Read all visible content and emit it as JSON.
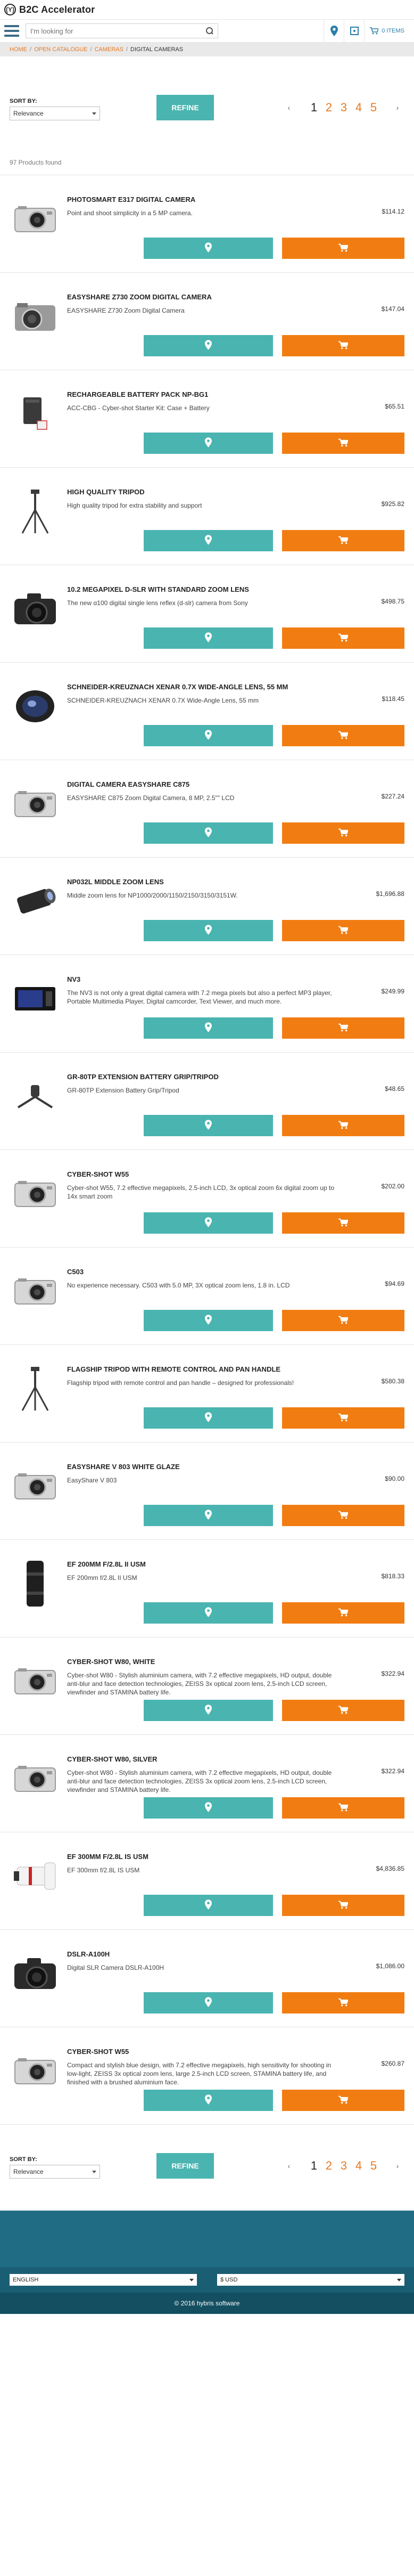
{
  "site": {
    "logo_mark": "(Y)",
    "title": "B2C Accelerator"
  },
  "search": {
    "placeholder": "I'm looking for"
  },
  "header": {
    "cart_label": "0 ITEMS",
    "icons": [
      "menu-icon",
      "search-icon",
      "store-locator-icon",
      "wishlist-icon",
      "cart-icon"
    ]
  },
  "breadcrumb": [
    {
      "label": "HOME"
    },
    {
      "label": "OPEN CATALOGUE"
    },
    {
      "label": "CAMERAS"
    },
    {
      "label": "DIGITAL CAMERAS"
    }
  ],
  "sort": {
    "label": "SORT BY:",
    "value": "Relevance",
    "refine_label": "REFINE"
  },
  "pager": {
    "pages": [
      "1",
      "2",
      "3",
      "4",
      "5"
    ],
    "current": "1"
  },
  "results_count": "97 Products found",
  "products": [
    {
      "name": "PHOTOSMART E317 DIGITAL CAMERA",
      "desc": "Point and shoot simplicity in a 5 MP camera.",
      "price": "$114.12",
      "icon": "compact-camera-icon"
    },
    {
      "name": "EASYSHARE Z730 ZOOM DIGITAL CAMERA",
      "desc": "EASYSHARE Z730 Zoom Digital Camera",
      "price": "$147.04",
      "icon": "bridge-camera-icon"
    },
    {
      "name": "RECHARGEABLE BATTERY PACK NP-BG1",
      "desc": "ACC-CBG - Cyber-shot Starter Kit: Case + Battery",
      "price": "$65.51",
      "icon": "battery-pack-icon"
    },
    {
      "name": "HIGH QUALITY TRIPOD",
      "desc": "High quality tripod for extra stability and support",
      "price": "$925.82",
      "icon": "tripod-icon"
    },
    {
      "name": "10.2 MEGAPIXEL D-SLR WITH STANDARD ZOOM LENS",
      "desc": "The new α100 digital single lens reflex (d-slr) camera from Sony",
      "price": "$498.75",
      "icon": "dslr-camera-icon"
    },
    {
      "name": "SCHNEIDER-KREUZNACH XENAR 0.7X WIDE-ANGLE LENS, 55 MM",
      "desc": "SCHNEIDER-KREUZNACH XENAR 0.7X Wide-Angle Lens, 55 mm",
      "price": "$118.45",
      "icon": "wide-angle-lens-icon"
    },
    {
      "name": "DIGITAL CAMERA EASYSHARE C875",
      "desc": "EASYSHARE C875 Zoom Digital Camera, 8 MP, 2.5\"\" LCD",
      "price": "$227.24",
      "icon": "compact-camera-icon"
    },
    {
      "name": "NP032L MIDDLE ZOOM LENS",
      "desc": "Middle zoom lens for NP1000/2000/1150/2150/3150/3151W.",
      "price": "$1,696.88",
      "icon": "zoom-lens-icon"
    },
    {
      "name": "NV3",
      "desc": "The NV3 is not only a great digital camera with 7.2 mega pixels but also a perfect MP3 player, Portable Multimedia Player, Digital camcorder, Text Viewer, and much more.",
      "price": "$249.99",
      "icon": "slim-camera-icon"
    },
    {
      "name": "GR-80TP EXTENSION BATTERY GRIP/TRIPOD",
      "desc": "GR-80TP Extension Battery Grip/Tripod",
      "price": "$48.65",
      "icon": "grip-tripod-icon"
    },
    {
      "name": "CYBER-SHOT W55",
      "desc": "Cyber-shot W55, 7.2 effective megapixels, 2.5-inch LCD, 3x optical zoom 6x digital zoom up to 14x smart zoom",
      "price": "$202.00",
      "icon": "compact-camera-icon"
    },
    {
      "name": "C503",
      "desc": "No experience necessary. C503 with 5.0 MP, 3X optical zoom lens, 1.8 in. LCD",
      "price": "$94.69",
      "icon": "compact-camera-icon"
    },
    {
      "name": "FLAGSHIP TRIPOD WITH REMOTE CONTROL AND PAN HANDLE",
      "desc": "Flagship tripod with remote control and pan handle – designed for professionals!",
      "price": "$580.38",
      "icon": "tripod-icon"
    },
    {
      "name": "EASYSHARE V 803 WHITE GLAZE",
      "desc": "EasyShare V 803",
      "price": "$90.00",
      "icon": "compact-camera-icon"
    },
    {
      "name": "EF 200MM F/2.8L II USM",
      "desc": "EF 200mm f/2.8L II USM",
      "price": "$818.33",
      "icon": "telephoto-lens-icon"
    },
    {
      "name": "CYBER-SHOT W80, WHITE",
      "desc": "Cyber-shot W80 - Stylish aluminium camera, with 7.2 effective megapixels, HD output, double anti-blur and face detection technologies, ZEISS 3x optical zoom lens, 2.5-inch LCD screen, viewfinder and STAMINA battery life.",
      "price": "$322.94",
      "icon": "compact-camera-icon"
    },
    {
      "name": "CYBER-SHOT W80, SILVER",
      "desc": "Cyber-shot W80 - Stylish aluminium camera, with 7.2 effective megapixels, HD output, double anti-blur and face detection technologies, ZEISS 3x optical zoom lens, 2.5-inch LCD screen, viewfinder and STAMINA battery life.",
      "price": "$322.94",
      "icon": "compact-camera-icon"
    },
    {
      "name": "EF 300MM F/2.8L IS USM",
      "desc": "EF 300mm f/2.8L IS USM",
      "price": "$4,836.85",
      "icon": "white-telephoto-lens-icon"
    },
    {
      "name": "DSLR-A100H",
      "desc": "Digital SLR Camera DSLR-A100H",
      "price": "$1,086.00",
      "icon": "dslr-camera-icon"
    },
    {
      "name": "CYBER-SHOT W55",
      "desc": "Compact and stylish blue design, with 7.2 effective megapixels, high sensitivity for shooting in low-light, ZEISS 3x optical zoom lens, large 2.5-inch LCD screen, STAMINA battery life, and finished with a brushed aluminium face.",
      "price": "$260.87",
      "icon": "compact-camera-icon"
    }
  ],
  "product_actions": {
    "store_icon": "store-locator-icon",
    "cart_icon": "add-to-cart-icon"
  },
  "footer": {
    "language": "ENGLISH",
    "currency": "$ USD",
    "copyright": "© 2016 hybris software"
  },
  "colors": {
    "teal": "#4ab4b0",
    "orange": "#f17d12",
    "brand_blue": "#3d6b84",
    "footer_top": "#1f6c84",
    "footer_mid": "#1a5e73",
    "footer_bottom": "#144f61"
  }
}
